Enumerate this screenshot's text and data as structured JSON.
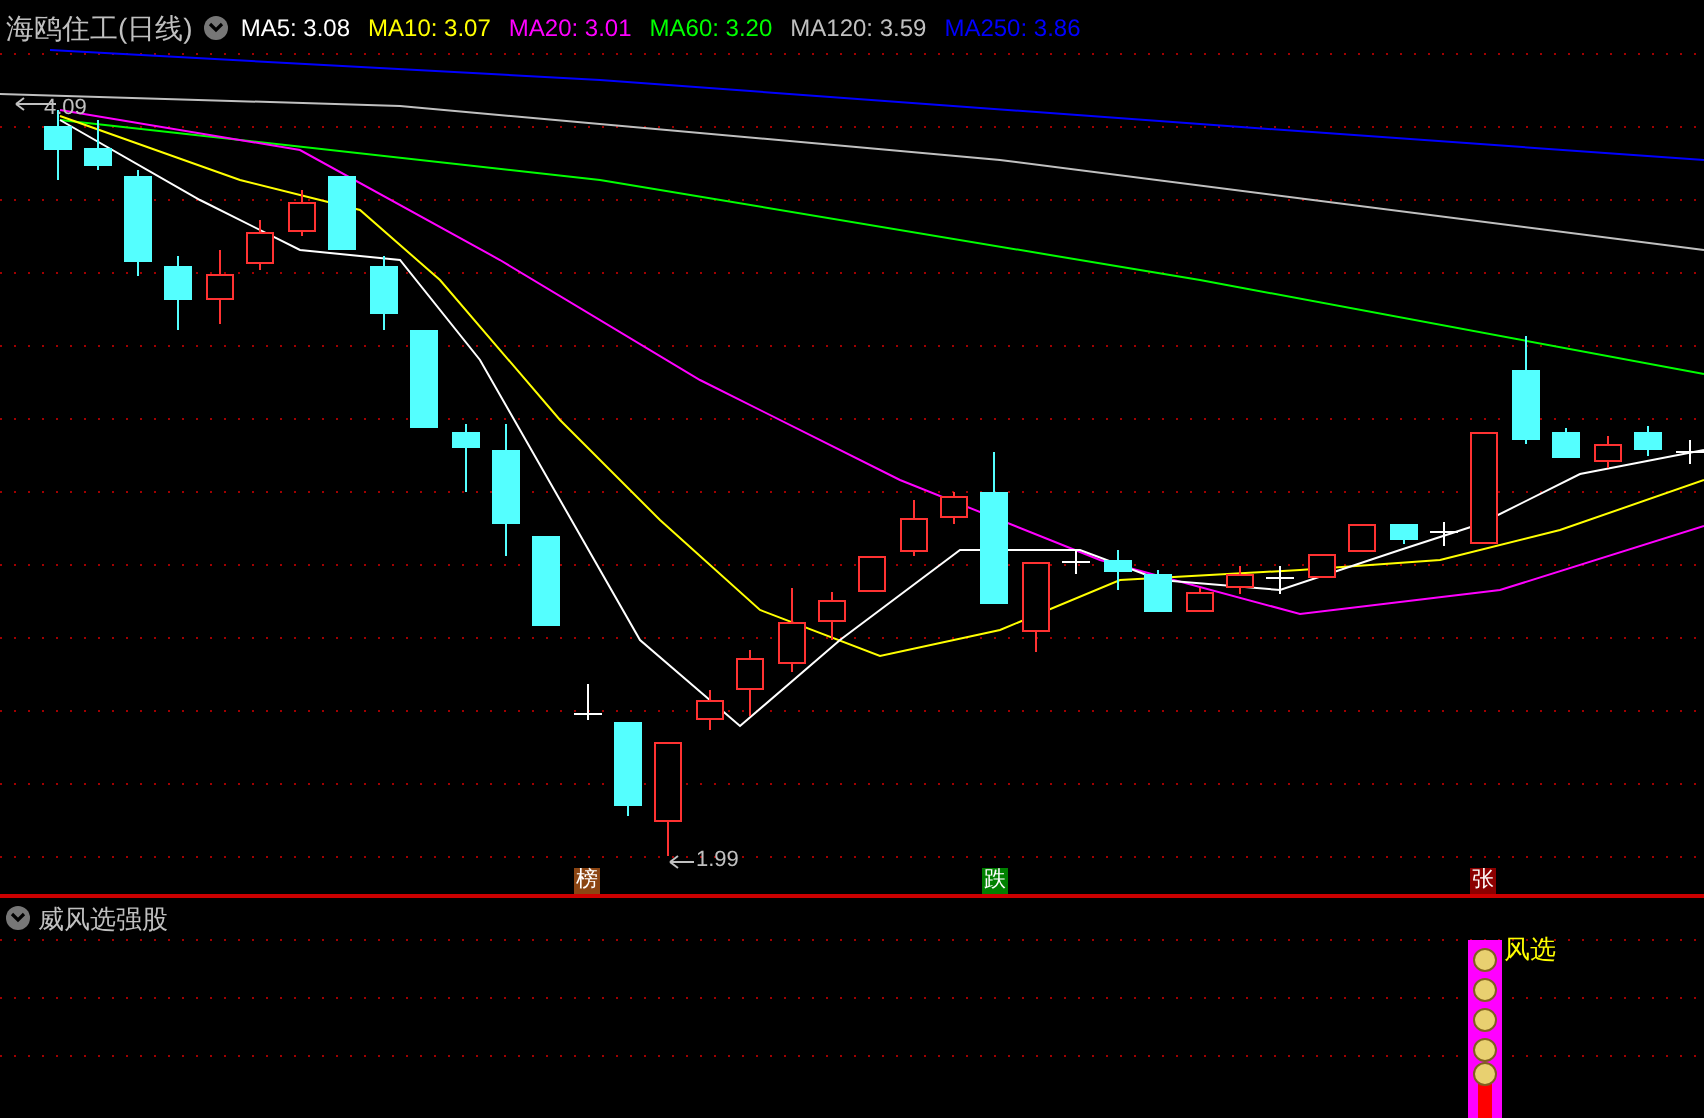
{
  "main_panel": {
    "title": "海鸥住工(日线)",
    "indicators": [
      {
        "text": "MA5: 3.08",
        "color": "#ffffff"
      },
      {
        "text": "MA10: 3.07",
        "color": "#ffff00"
      },
      {
        "text": "MA20: 3.01",
        "color": "#ff00ff"
      },
      {
        "text": "MA60: 3.20",
        "color": "#00ff00"
      },
      {
        "text": "MA120: 3.59",
        "color": "#c0c0c0"
      },
      {
        "text": "MA250: 3.86",
        "color": "#0000ff"
      }
    ],
    "high_label": "4.09",
    "low_label": "1.99",
    "markers": [
      {
        "text": "榜",
        "color": "#8b4513"
      },
      {
        "text": "跌",
        "color": "#008000"
      },
      {
        "text": "张",
        "color": "#8b0000"
      }
    ]
  },
  "sub_panel": {
    "title": "威风选强股",
    "signal_label": "风选"
  }
}
